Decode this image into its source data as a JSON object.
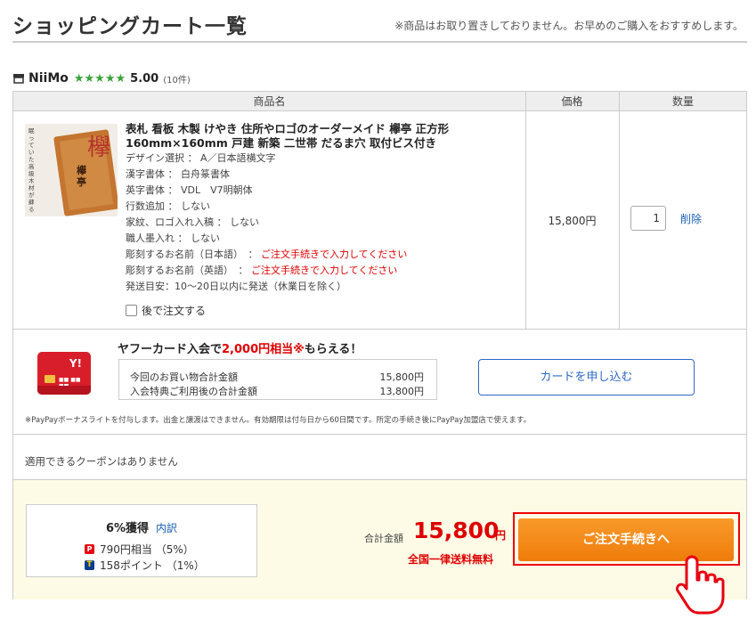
{
  "page": {
    "title": "ショッピングカート一覧",
    "notice": "※商品はお取り置きしておりません。お早めのご購入をおすすめします。"
  },
  "store": {
    "name": "NiiMo",
    "stars": "★★★★★",
    "rating": "5.00",
    "reviews": "(10件)",
    "star_color": "#3aa23a"
  },
  "table": {
    "headers": [
      "商品名",
      "価格",
      "数量"
    ]
  },
  "item": {
    "thumb_char": "欅",
    "thumb_small": "欅亭",
    "thumb_side": "眠っていた高級木材が蘇る",
    "title": "表札 看板 木製 けやき 住所やロゴのオーダーメイド 欅亭 正方形160mm×160mm 戸建 新築 二世帯 だるま穴 取付ビス付き",
    "options": [
      {
        "label": "デザイン選択 ： A／日本語横文字",
        "note": ""
      },
      {
        "label": "漢字書体 ： 白舟篆書体",
        "note": ""
      },
      {
        "label": "英字書体 ： VDL　V7明朝体",
        "note": ""
      },
      {
        "label": "行数追加 ： しない",
        "note": ""
      },
      {
        "label": "家紋、ロゴ入れ入稿 ： しない",
        "note": ""
      },
      {
        "label": "職人墨入れ ： しない",
        "note": ""
      },
      {
        "label": "彫刻するお名前（日本語）　：",
        "note": "ご注文手続きで入力してください"
      },
      {
        "label": "彫刻するお名前（英語）　：",
        "note": "ご注文手続きで入力してください"
      },
      {
        "label": "発送目安：10～20日以内に発送（休業日を除く）",
        "note": ""
      }
    ],
    "later_label": "後で注文する",
    "price": "15,800円",
    "quantity": "1",
    "delete_label": "削除"
  },
  "ad": {
    "card_logo": "Y!",
    "headline_prefix": "ヤフーカード入会で",
    "headline_highlight": "2,000円相当※",
    "headline_suffix": "もらえる！",
    "rows": [
      {
        "label": "今回のお買い物合計金額",
        "value": "15,800円"
      },
      {
        "label": "入会特典ご利用後の合計金額",
        "value": "13,800円"
      }
    ],
    "button_label": "カードを申し込む",
    "fineprint": "※PayPayボーナスライトを付与します。出金と譲渡はできません。有効期限は付与日から60日間です。所定の手続き後にPayPay加盟店で使えます。"
  },
  "coupon": {
    "text": "適用できるクーポンはありません"
  },
  "points": {
    "title": "6%獲得",
    "detail_link": "内訳",
    "paypay_icon": "P",
    "tpoint_icon": "T",
    "paypay_line": "790円相当 （5%）",
    "tpoint_line": "158ポイント （1%）"
  },
  "total": {
    "label": "合計金額",
    "value": "15,800",
    "unit": "円",
    "shipping": "全国一律送料無料"
  },
  "checkout": {
    "label": "ご注文手続きへ",
    "color": "#ef7c0b"
  },
  "colors": {
    "accent_red": "#dd0000",
    "link_blue": "#1a5fb4"
  }
}
